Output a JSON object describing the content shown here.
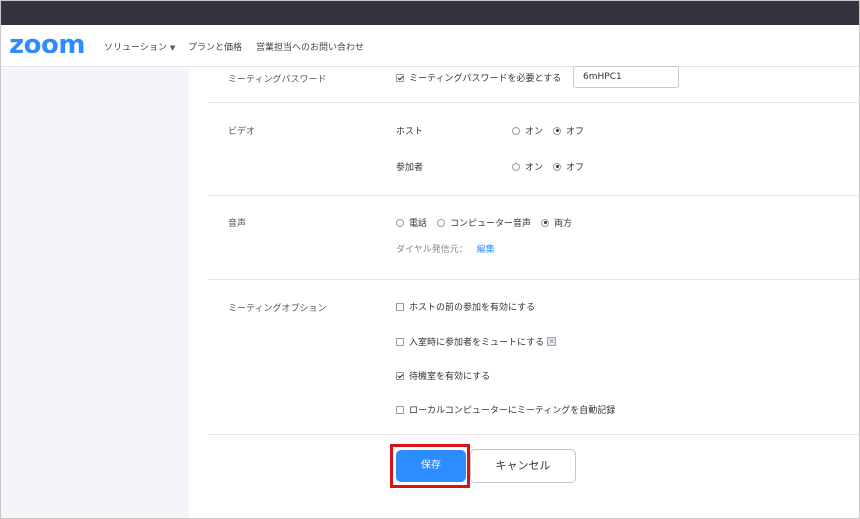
{
  "header": {
    "logo": "zoom",
    "nav": [
      {
        "label": "ソリューション"
      },
      {
        "label": "プランと価格"
      },
      {
        "label": "営業担当へのお問い合わせ"
      }
    ]
  },
  "settings": {
    "password": {
      "label": "ミーティングパスワード",
      "checkbox_label": "ミーティングパスワードを必要とする",
      "checked": true,
      "value": "6mHPC1"
    },
    "video": {
      "label": "ビデオ",
      "host": {
        "label": "ホスト",
        "on": "オン",
        "off": "オフ",
        "selected": "オフ"
      },
      "participant": {
        "label": "参加者",
        "on": "オン",
        "off": "オフ",
        "selected": "オフ"
      }
    },
    "audio": {
      "label": "音声",
      "options": [
        "電話",
        "コンピューター音声",
        "両方"
      ],
      "selected": "両方",
      "dial_from_label": "ダイヤル発信元：",
      "edit_link": "編集"
    },
    "meeting_options": {
      "label": "ミーティングオプション",
      "items": [
        {
          "label": "ホストの前の参加を有効にする",
          "checked": false
        },
        {
          "label": "入室時に参加者をミュートにする",
          "checked": false
        },
        {
          "label": "待機室を有効にする",
          "checked": true
        },
        {
          "label": "ローカルコンピューターにミーティングを自動記録",
          "checked": false
        }
      ]
    }
  },
  "buttons": {
    "save": "保存",
    "cancel": "キャンセル"
  },
  "colors": {
    "accent": "#2D8CFF",
    "topbar": "#34343E",
    "highlight": "#D6121A"
  }
}
